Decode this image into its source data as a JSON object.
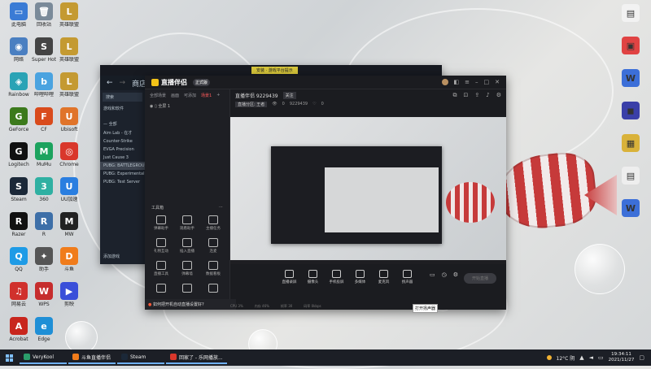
{
  "desktop": {
    "left_icons": [
      {
        "label": "此电脑",
        "color": "#3a7bd5",
        "glyph": "▭"
      },
      {
        "label": "回收站",
        "color": "#7a8a99",
        "glyph": "🗑"
      },
      {
        "label": "英雄联盟",
        "color": "#c49a32",
        "glyph": "L"
      },
      {
        "label": "网络",
        "color": "#4a7fc1",
        "glyph": "◉"
      },
      {
        "label": "Super Hot",
        "color": "#444",
        "glyph": "S"
      },
      {
        "label": "英雄联盟",
        "color": "#c49a32",
        "glyph": "L"
      },
      {
        "label": "Rainbow",
        "color": "#2aa3b5",
        "glyph": "◈"
      },
      {
        "label": "哔哩哔哩",
        "color": "#4aa3e0",
        "glyph": "b"
      },
      {
        "label": "英雄联盟",
        "color": "#c49a32",
        "glyph": "L"
      },
      {
        "label": "GeForce",
        "color": "#3c7a1c",
        "glyph": "G"
      },
      {
        "label": "CF",
        "color": "#d94b1c",
        "glyph": "F"
      },
      {
        "label": "Ubisoft",
        "color": "#e0742a",
        "glyph": "U"
      },
      {
        "label": "Logitech",
        "color": "#111",
        "glyph": "G"
      },
      {
        "label": "MuMu",
        "color": "#1ca35e",
        "glyph": "M"
      },
      {
        "label": "Chrome",
        "color": "#d9372b",
        "glyph": "◎"
      },
      {
        "label": "Steam",
        "color": "#1b2838",
        "glyph": "S"
      },
      {
        "label": "360",
        "color": "#2fb0a2",
        "glyph": "3"
      },
      {
        "label": "UU加速",
        "color": "#2a7ee0",
        "glyph": "U"
      },
      {
        "label": "Razer",
        "color": "#111",
        "glyph": "R"
      },
      {
        "label": "R",
        "color": "#3d6fa8",
        "glyph": "R"
      },
      {
        "label": "MW",
        "color": "#222",
        "glyph": "M"
      },
      {
        "label": "QQ",
        "color": "#1e9be6",
        "glyph": "Q"
      },
      {
        "label": "助手",
        "color": "#555",
        "glyph": "✦"
      },
      {
        "label": "斗鱼",
        "color": "#f07c1b",
        "glyph": "D"
      },
      {
        "label": "网易云",
        "color": "#d0312d",
        "glyph": "♫"
      },
      {
        "label": "WPS",
        "color": "#c62d2d",
        "glyph": "W"
      },
      {
        "label": "剪映",
        "color": "#3a4fd9",
        "glyph": "▶"
      },
      {
        "label": "Acrobat",
        "color": "#c8261d",
        "glyph": "A"
      },
      {
        "label": "Edge",
        "color": "#1f8fd6",
        "glyph": "e"
      }
    ],
    "right_icons": [
      {
        "label": "",
        "color": "#f2f2f2",
        "glyph": "▤"
      },
      {
        "label": "",
        "color": "#e04343",
        "glyph": "▣"
      },
      {
        "label": "",
        "color": "#3c6fd8",
        "glyph": "W"
      },
      {
        "label": "",
        "color": "#3a3fa8",
        "glyph": "◼"
      },
      {
        "label": "",
        "color": "#d9b23a",
        "glyph": "▦"
      },
      {
        "label": "",
        "color": "#eeeeee",
        "glyph": "▤"
      },
      {
        "label": "",
        "color": "#3c6fd8",
        "glyph": "W"
      }
    ]
  },
  "steam_window": {
    "title": "商店",
    "back_icon": "back-arrow-icon",
    "game_button": "安装 · 游戏平台提示",
    "side_search": "搜索",
    "side_section": "游戏和软件",
    "side_heading": "— 全部",
    "side_items": [
      "Aim Lab - 在才",
      "Counter-Strike",
      "EVGA Precision",
      "Just Cause 3",
      "PUBG: BATTLEGROUNDS",
      "PUBG: Experimental",
      "PUBG: Test Server"
    ],
    "add_game": "添加游戏"
  },
  "obs_window": {
    "app_name": "直播伴侣",
    "version": "正式版",
    "left_tabs": [
      "全部场景",
      "画面",
      "可添加",
      "场景1"
    ],
    "active_tab_index": 3,
    "scene_label": "全屏 1",
    "tools_header": "工具箱",
    "tools": [
      {
        "label": "弹幕助手",
        "icon": "chat-bubble-icon"
      },
      {
        "label": "观看助手",
        "icon": "user-icon"
      },
      {
        "label": "主播任务",
        "icon": "flag-icon"
      },
      {
        "label": "礼物互动",
        "icon": "gift-icon"
      },
      {
        "label": "插入直播",
        "icon": "download-icon"
      },
      {
        "label": "连麦",
        "icon": "link-icon"
      },
      {
        "label": "直播工具",
        "icon": "wrench-icon"
      },
      {
        "label": "弹幕墙",
        "icon": "grid-icon"
      },
      {
        "label": "数据看板",
        "icon": "chart-icon"
      },
      {
        "label": "",
        "icon": "fan-icon"
      },
      {
        "label": "",
        "icon": "frame-icon"
      },
      {
        "label": "",
        "icon": "settings-icon"
      }
    ],
    "bottom_tip": "如何把开机自动直播设置好?",
    "room": {
      "title": "直播伴侣 9229439",
      "follow": "关注",
      "tag": "直播分区: 王者",
      "viewers": "0",
      "room_id": "9229439",
      "likes": "0"
    },
    "header_icons": [
      "layers-icon",
      "lock-icon",
      "share-icon",
      "bell-icon",
      "gear-icon"
    ],
    "controls": [
      {
        "label": "直播录屏",
        "icon": "screen-record-icon"
      },
      {
        "label": "摄像头",
        "icon": "camera-icon"
      },
      {
        "label": "手机投屏",
        "icon": "phone-cast-icon"
      },
      {
        "label": "多媒体",
        "icon": "media-icon"
      },
      {
        "label": "麦克风",
        "icon": "mic-icon"
      },
      {
        "label": "扬声器",
        "icon": "speaker-icon"
      }
    ],
    "start_button": "开始直播",
    "status_items": [
      "CPU 3%",
      "内存 46%",
      "帧率 30",
      "码率 0kbps"
    ],
    "tooltip": "打开扬声器"
  },
  "taskbar": {
    "items": [
      {
        "label": "VeryKool",
        "color": "#2a9d6a"
      },
      {
        "label": "斗鱼直播伴侣",
        "color": "#f07c1b"
      },
      {
        "label": "Steam",
        "color": "#1b2838"
      },
      {
        "label": "回家了 - 乐网播放...",
        "color": "#d9372b"
      }
    ],
    "weather": "12°C 阴",
    "time": "19:34:11",
    "date": "2021/11/27"
  }
}
